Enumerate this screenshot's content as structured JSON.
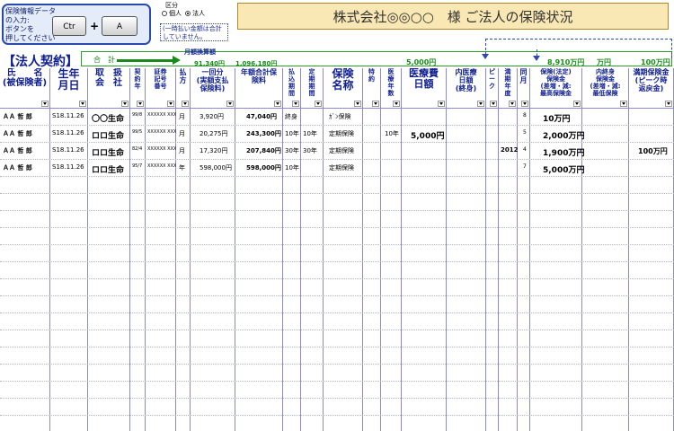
{
  "input_box": {
    "text_line1": "保険情報データの入力:",
    "text_line2": "ボタンを",
    "text_line3": "押してください",
    "ctrl_key": "Ctr",
    "plus": "+",
    "a_key": "A"
  },
  "kubun": {
    "label": "区分",
    "options": [
      {
        "label": "個人",
        "selected": false
      },
      {
        "label": "法人",
        "selected": true
      }
    ]
  },
  "note": "(一時払い金額は合計していません。",
  "page_title": "株式会社◎◎○○　様 ご法人の保険状況",
  "section_title": "【法人契約】",
  "totals": {
    "label": "合　計",
    "monthly_label": "月額換算額",
    "monthly_value": "91,340円",
    "annual_value": "1,096,180円",
    "medical_value": "5,000円",
    "death_value": "8,910万円",
    "living_value": "万円",
    "full_value": "100万円"
  },
  "headers": [
    {
      "key": "name",
      "lines": [
        "氏　　名",
        "(被保険者)"
      ]
    },
    {
      "key": "birth",
      "lines": [
        "生年",
        "月日"
      ]
    },
    {
      "key": "company",
      "lines": [
        "取　扱",
        "会　社"
      ]
    },
    {
      "key": "contract_year",
      "lines": [
        "契",
        "約",
        "年"
      ]
    },
    {
      "key": "policy_no",
      "lines": [
        "証券",
        "記号",
        "番号"
      ]
    },
    {
      "key": "pay",
      "lines": [
        "払",
        "方"
      ]
    },
    {
      "key": "per_payment",
      "lines": [
        "一回分",
        "(実額支払",
        "保険料)"
      ]
    },
    {
      "key": "annual",
      "lines": [
        "年額合計保",
        "険料"
      ]
    },
    {
      "key": "pay_period",
      "lines": [
        "払",
        "込",
        "期",
        "間"
      ]
    },
    {
      "key": "term",
      "lines": [
        "定",
        "期",
        "期",
        "間"
      ]
    },
    {
      "key": "ins_name",
      "lines": [
        "保険",
        "名称"
      ]
    },
    {
      "key": "rider",
      "lines": [
        "特",
        "約"
      ]
    },
    {
      "key": "medical_years",
      "lines": [
        "医",
        "療",
        "年",
        "数"
      ]
    },
    {
      "key": "medical_daily",
      "lines": [
        "医療費",
        "日額"
      ]
    },
    {
      "key": "internal_medical",
      "lines": [
        "内医療",
        "日額",
        "(終身)"
      ]
    },
    {
      "key": "peak",
      "lines": [
        "ピ",
        "ー",
        "ク"
      ]
    },
    {
      "key": "maturity_year",
      "lines": [
        "満",
        "期",
        "年",
        "度"
      ]
    },
    {
      "key": "same_month",
      "lines": [
        "同",
        "月"
      ]
    },
    {
      "key": "death_benefit",
      "lines": [
        "保険(法定)",
        "保険金",
        "(差増・減:",
        "最高保険金"
      ]
    },
    {
      "key": "lifetime_benefit",
      "lines": [
        "内終身",
        "保険金",
        "(差増・減:",
        "最低保険"
      ]
    },
    {
      "key": "maturity_benefit",
      "lines": [
        "満期保険金",
        "(ピーク時",
        "返戻金)"
      ]
    }
  ],
  "rows": [
    {
      "name": "ＡＡ 哲 郎",
      "birth": "S18.11.26",
      "company": "〇〇生命",
      "contract_year": "99/8",
      "policy_no": "XXXXXX XXX",
      "pay": "月",
      "per_payment": "3,920円",
      "annual": "47,040円",
      "pay_period": "終身",
      "term": "",
      "ins_name": "ｶﾞﾝ保険",
      "medical_years": "",
      "medical_daily": "",
      "maturity_year": "",
      "same_month": "8",
      "death_benefit": "10万円",
      "maturity_benefit": ""
    },
    {
      "name": "ＡＡ 哲 郎",
      "birth": "S18.11.26",
      "company": "ロロ生命",
      "contract_year": "99/5",
      "policy_no": "XXXXXX XXX",
      "pay": "月",
      "per_payment": "20,275円",
      "annual": "243,300円",
      "pay_period": "10年",
      "term": "10年",
      "ins_name": "定期保険",
      "medical_years": "10年",
      "medical_daily": "5,000円",
      "maturity_year": "",
      "same_month": "5",
      "death_benefit": "2,000万円",
      "maturity_benefit": ""
    },
    {
      "name": "ＡＡ 哲 郎",
      "birth": "S18.11.26",
      "company": "ロロ生命",
      "contract_year": "82/4",
      "policy_no": "XXXXXX XXX",
      "pay": "月",
      "per_payment": "17,320円",
      "annual": "207,840円",
      "pay_period": "30年",
      "term": "30年",
      "ins_name": "定期保険",
      "medical_years": "",
      "medical_daily": "",
      "maturity_year": "2012",
      "same_month": "4",
      "death_benefit": "1,900万円",
      "maturity_benefit": "100万円"
    },
    {
      "name": "ＡＡ 哲 郎",
      "birth": "S18.11.26",
      "company": "ロロ生命",
      "contract_year": "95/7",
      "policy_no": "XXXXXX XXX",
      "pay": "年",
      "per_payment": "598,000円",
      "annual": "598,000円",
      "pay_period": "10年",
      "term": "",
      "ins_name": "定期保険",
      "medical_years": "",
      "medical_daily": "",
      "maturity_year": "",
      "same_month": "7",
      "death_benefit": "5,000万円",
      "maturity_benefit": ""
    }
  ]
}
